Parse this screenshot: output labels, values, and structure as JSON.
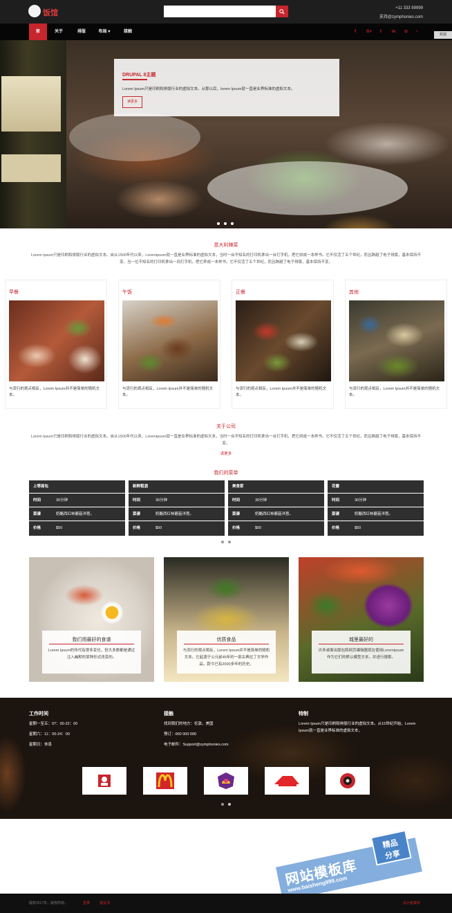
{
  "header": {
    "logo_text": "饭馆",
    "search": {
      "placeholder": "",
      "button_icon": "search-icon"
    },
    "phone": "+11 333 99999",
    "support": "支持@zymphonies.com"
  },
  "nav": {
    "items": [
      "家",
      "关于",
      "排版",
      "布局",
      "接触"
    ],
    "active": "家",
    "dropdown_item": "布局",
    "social": [
      "f",
      "G+",
      "t",
      "in",
      "p",
      "rss"
    ],
    "welcome_tab": "欢迎"
  },
  "hero": {
    "title": "DRUPAL 8主题",
    "text": "Lorem Ipsum只是印刷和排版行业的虚拟文本。从那以后，lorem Ipsum就一直是业界标准的虚拟文本。",
    "button": "读更多",
    "slides": 3
  },
  "intro": {
    "title": "意大利辣菜",
    "text": "Lorem Ipsum只是印刷和排版行业的虚拟文本。自从1500年代以来，Loremipsum就一直是业界标准的虚拟文本，当时一台不知名的打印机拿出一台打字机，把它拼成一本样书。它不仅活了五个世纪，而且跨越了电子排版，基本保持不变。当一位不知名的打印机拿出一间打字机，把它弄成一本样书。它不仅活了五个世纪，而且跨越了电子排版，基本保持不变。"
  },
  "meals": [
    {
      "title": "早餐",
      "text": "与流行的观点相反，Lorem Ipsum并不是简单的随机文本。"
    },
    {
      "title": "午饭",
      "text": "与流行的观点相反，Lorem Ipsum并不是简单的随机文本。"
    },
    {
      "title": "正餐",
      "text": "与流行的观点相反，Lorem Ipsum并不是简单的随机文本。"
    },
    {
      "title": "其他",
      "text": "与流行的观点相反，Lorem Ipsum并不是简单的随机文本。"
    }
  ],
  "about": {
    "title": "关于公司",
    "text": "Lorem Ipsum只是印刷和排版行业的虚拟文本。自从1500年代以来，Loremipsum就一直是业界标准的虚拟文本，当时一台不知名的打印机拿出一台打字机，把它拼成一本样书。它不仅活了五个世纪，而且跨越了电子排版，基本保持不变。",
    "link": "读更多"
  },
  "menu": {
    "title": "我们的菜单",
    "labels": {
      "time": "时间",
      "dish": "菜谱",
      "price": "价格"
    },
    "cards": [
      {
        "name": "上等面包",
        "time": "30分钟",
        "dish": "奶酪西红柿蘑菇洋葱。",
        "price": "$50"
      },
      {
        "name": "新鲜粗酒",
        "time": "30分钟",
        "dish": "奶酪西红柿蘑菇洋葱。",
        "price": "$50"
      },
      {
        "name": "美食家",
        "time": "30分钟",
        "dish": "奶酪西红柿蘑菇洋葱。",
        "price": "$50"
      },
      {
        "name": "花蕾",
        "time": "30分钟",
        "dish": "奶酪西红柿蘑菇洋葱。",
        "price": "$50"
      }
    ]
  },
  "featured": [
    {
      "title": "我们用最好的食谱",
      "text": "Lorem Ipsum的传代有很多变化，但大多数都是通过注入幽默的某种形式改变的。"
    },
    {
      "title": "优质食品",
      "text": "与流行的观点相反，Lorem Ipsum并不是简单的随机文本。它起源于公元前45年的一部古典拉丁文学作品，距今已有2000多年的历史。"
    },
    {
      "title": "城里最好的",
      "text": "许多桌面出版包和网页编辑器现在使用Loremipsum作为它们的默认模型文本，并进行搜索。"
    }
  ],
  "footer": {
    "hours": {
      "title": "工作时间",
      "lines": [
        "星期一至五：07：00-22：00",
        "星期六：11：00-24：00",
        "星期日：休息"
      ]
    },
    "contact": {
      "title": "接触",
      "lines": [
        "找到我们的地方：伦敦，美国",
        "预订：000 000 000",
        "电子邮件：Support@zymphonies.com"
      ]
    },
    "special": {
      "title": "特制",
      "text": "Lorem Ipsum只是印刷和排版行业的虚拟文本。从15世纪开始，Lorem Ipsum就一直是业界标准的虚拟文本，"
    },
    "brands": [
      "kfc-logo",
      "mcdonalds-logo",
      "taco-bell-logo",
      "pizza-hut-logo",
      "red-brand-logo"
    ]
  },
  "bottom": {
    "copyright": "版权2017年，版权所有。",
    "links": [
      "登录",
      "建议书"
    ],
    "credit": "设计者莫科"
  },
  "watermark": {
    "title": "网站模板库",
    "url": "www.baisheng999.com",
    "badge_top": "精品",
    "badge_bottom": "分享"
  },
  "colors": {
    "accent": "#c8262d",
    "dark": "#1e1e1e",
    "menu_bg": "#2f2f2f"
  }
}
